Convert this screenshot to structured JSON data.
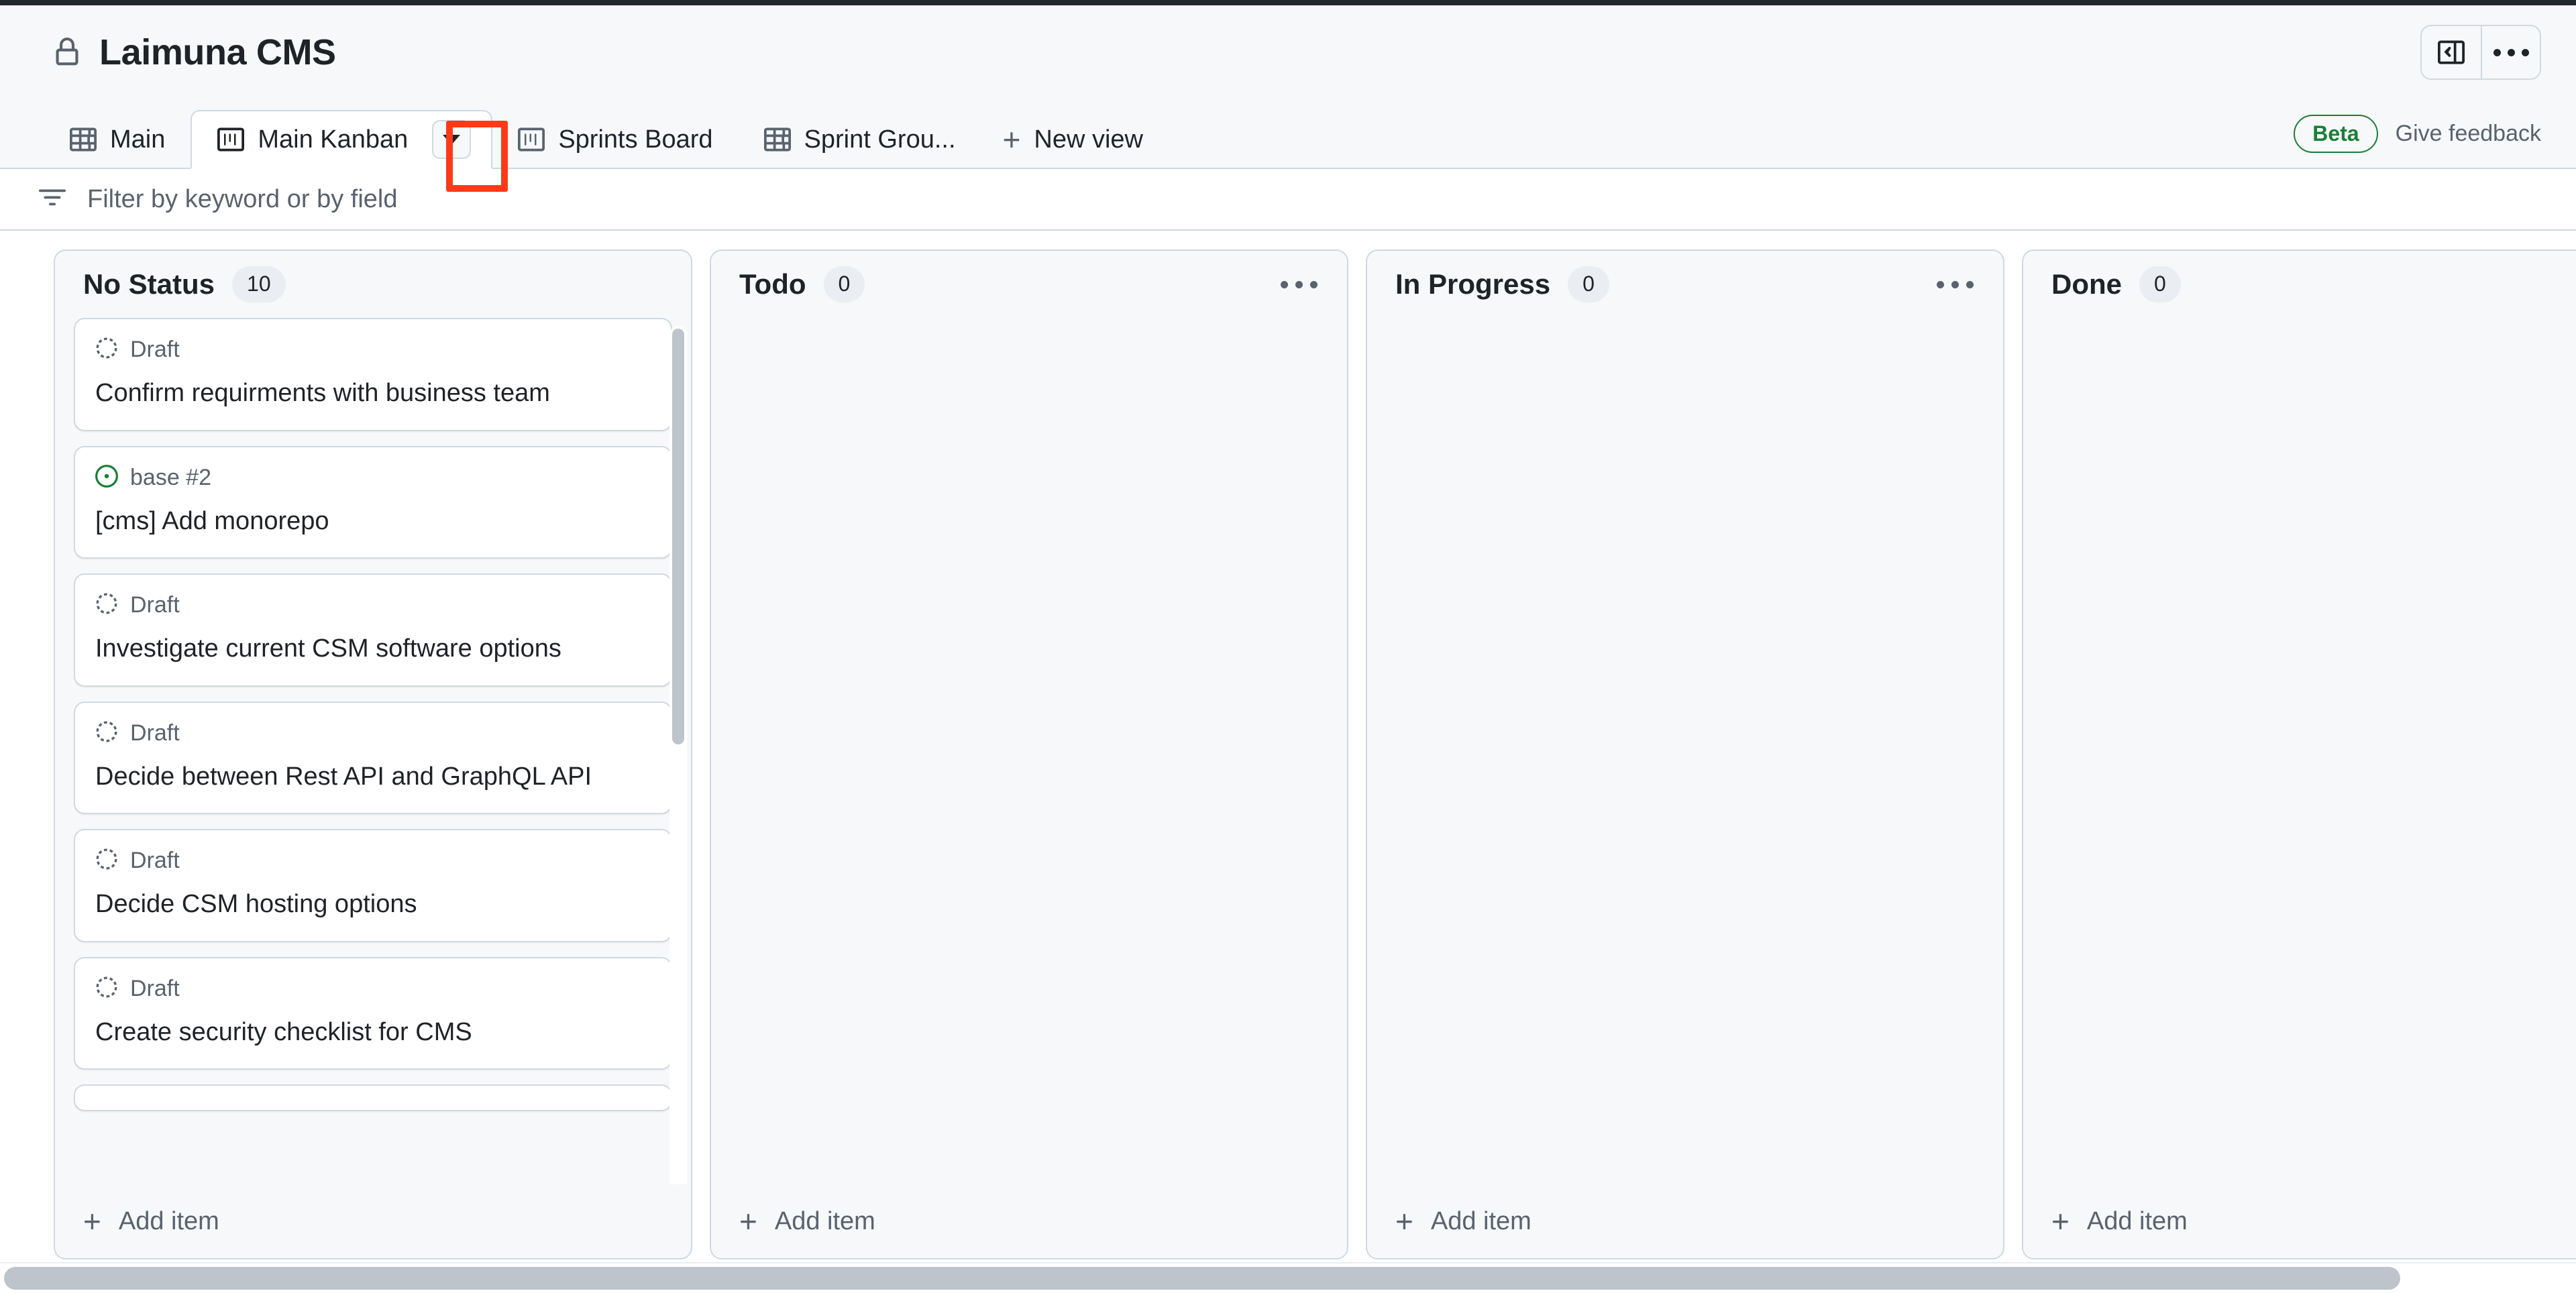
{
  "header": {
    "lock_icon": "lock-icon",
    "title": "Laimuna CMS",
    "sidebar_toggle_icon": "sidebar-collapse-icon",
    "more_options_icon": "kebab-horizontal-icon"
  },
  "tabs": {
    "items": [
      {
        "label": "Main",
        "icon": "table-view-icon",
        "active": false
      },
      {
        "label": "Main Kanban",
        "icon": "board-view-icon",
        "active": true
      },
      {
        "label": "Sprints Board",
        "icon": "board-view-icon",
        "active": false
      },
      {
        "label": "Sprint Grou...",
        "icon": "table-view-icon",
        "active": false
      }
    ],
    "active_tab_caret_icon": "triangle-down-icon",
    "new_view_label": "New view",
    "new_view_icon": "plus-icon",
    "beta_badge": "Beta",
    "feedback_label": "Give feedback"
  },
  "filter": {
    "icon": "filter-icon",
    "placeholder": "Filter by keyword or by field",
    "value": ""
  },
  "board": {
    "add_item_label": "Add item",
    "add_item_icon": "plus-icon",
    "column_menu_icon": "kebab-horizontal-icon",
    "columns": [
      {
        "title": "No Status",
        "count": "10",
        "has_menu": false,
        "has_scrollbar": true,
        "cards": [
          {
            "meta_icon": "draft-issue-icon",
            "meta": "Draft",
            "title": "Confirm requirments with business team"
          },
          {
            "meta_icon": "open-issue-icon",
            "meta": "base #2",
            "title": "[cms] Add monorepo"
          },
          {
            "meta_icon": "draft-issue-icon",
            "meta": "Draft",
            "title": "Investigate current CSM software options"
          },
          {
            "meta_icon": "draft-issue-icon",
            "meta": "Draft",
            "title": "Decide between Rest API and GraphQL API"
          },
          {
            "meta_icon": "draft-issue-icon",
            "meta": "Draft",
            "title": "Decide CSM hosting options"
          },
          {
            "meta_icon": "draft-issue-icon",
            "meta": "Draft",
            "title": "Create security checklist for CMS"
          }
        ]
      },
      {
        "title": "Todo",
        "count": "0",
        "has_menu": true,
        "has_scrollbar": false,
        "cards": []
      },
      {
        "title": "In Progress",
        "count": "0",
        "has_menu": true,
        "has_scrollbar": false,
        "cards": []
      },
      {
        "title": "Done",
        "count": "0",
        "has_menu": true,
        "has_scrollbar": false,
        "cards": []
      }
    ]
  },
  "annotation": {
    "color": "#fc3a18",
    "target": "active-tab-dropdown-caret"
  },
  "colors": {
    "page_bg": "#f6f8fa",
    "surface": "#ffffff",
    "border": "#d1d9e0",
    "text": "#1f2328",
    "muted": "#59636e",
    "green": "#1a7f37",
    "annotation_red": "#fc3a18"
  }
}
